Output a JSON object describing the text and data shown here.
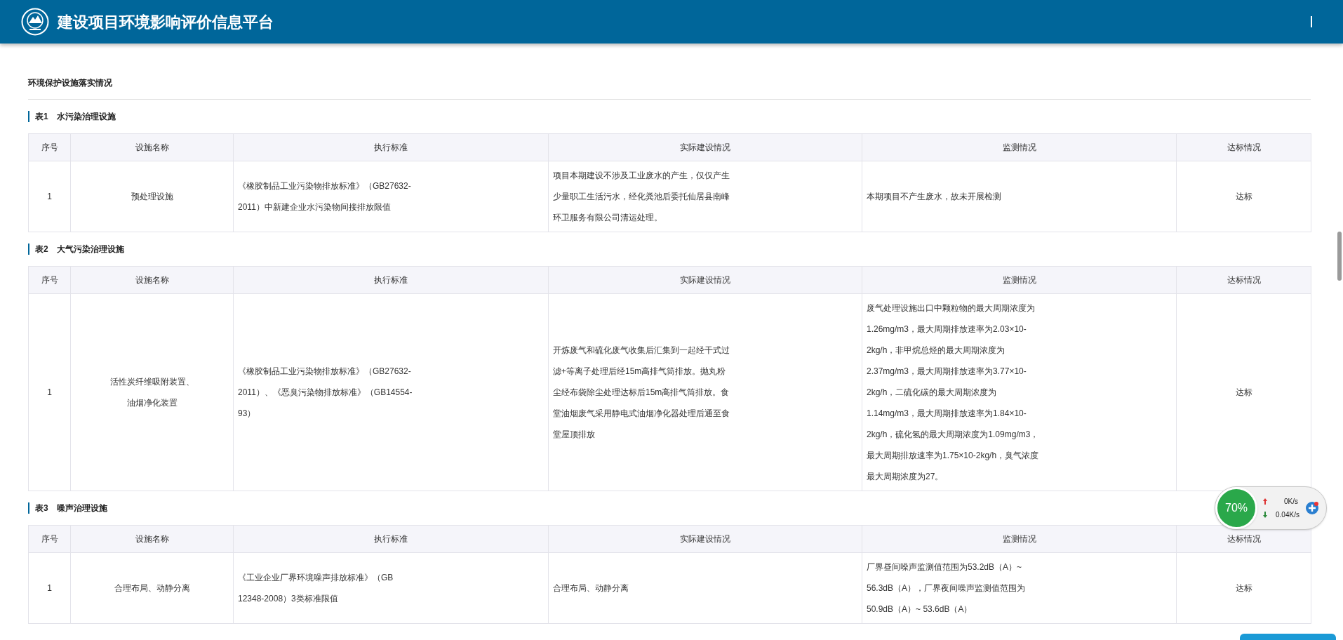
{
  "header": {
    "title": "建设项目环境影响评价信息平台"
  },
  "section_title": "环境保护设施落实情况",
  "tables": [
    {
      "label": "表1",
      "name": "水污染治理设施",
      "columns": [
        "序号",
        "设施名称",
        "执行标准",
        "实际建设情况",
        "监测情况",
        "达标情况"
      ],
      "rows": [
        {
          "cells": [
            "1",
            "预处理设施",
            "《橡胶制品工业污染物排放标准》（GB27632-2011）中新建企业水污染物间接排放限值",
            "项目本期建设不涉及工业废水的产生，仅仅产生少量职工生活污水，经化粪池后委托仙居县南峰环卫服务有限公司清运处理。",
            "本期项目不产生废水，故未开展检测",
            "达标"
          ]
        }
      ]
    },
    {
      "label": "表2",
      "name": "大气污染治理设施",
      "columns": [
        "序号",
        "设施名称",
        "执行标准",
        "实际建设情况",
        "监测情况",
        "达标情况"
      ],
      "rows": [
        {
          "cells": [
            "1",
            "活性炭纤维吸附装置、油烟净化装置",
            "《橡胶制品工业污染物排放标准》（GB27632-2011）、《恶臭污染物排放标准》（GB14554-93）",
            "开炼废气和硫化废气收集后汇集到一起经干式过滤+等离子处理后经15m高排气筒排放。抛丸粉尘经布袋除尘处理达标后15m高排气筒排放。食堂油烟废气采用静电式油烟净化器处理后通至食堂屋顶排放",
            "废气处理设施出口中颗粒物的最大周期浓度为1.26mg/m3，最大周期排放速率为2.03×10-2kg/h，非甲烷总烃的最大周期浓度为2.37mg/m3，最大周期排放速率为3.77×10-2kg/h，二硫化碳的最大周期浓度为1.14mg/m3，最大周期排放速率为1.84×10-2kg/h，硫化氢的最大周期浓度为1.09mg/m3，最大周期排放速率为1.75×10-2kg/h，臭气浓度最大周期浓度为27。",
            "达标"
          ]
        }
      ]
    },
    {
      "label": "表3",
      "name": "噪声治理设施",
      "columns": [
        "序号",
        "设施名称",
        "执行标准",
        "实际建设情况",
        "监测情况",
        "达标情况"
      ],
      "rows": [
        {
          "cells": [
            "1",
            "合理布局、动静分离",
            "《工业企业厂界环境噪声排放标准》（GB 12348-2008）3类标准限值",
            "合理布局、动静分离",
            "厂界昼间噪声监测值范围为53.2dB（A）~ 56.3dB（A），厂界夜间噪声监测值范围为50.9dB（A）~ 53.6dB（A）",
            "达标"
          ]
        }
      ]
    }
  ],
  "speed_widget": {
    "percent": "70%",
    "upload": "0K/s",
    "download": "0.04K/s"
  }
}
